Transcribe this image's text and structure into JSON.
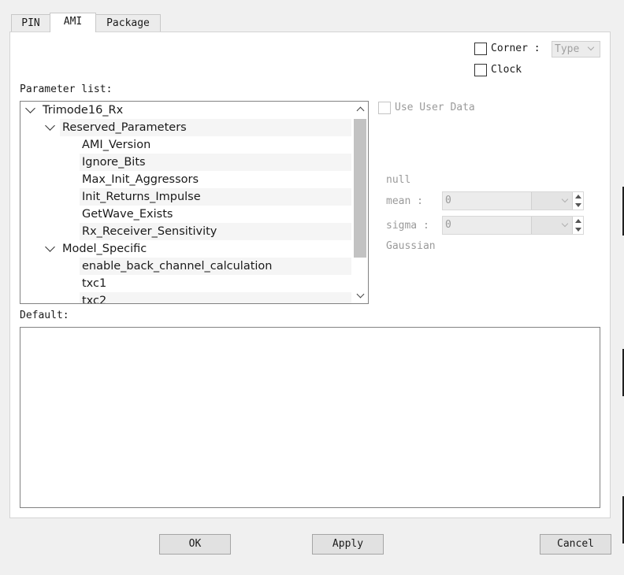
{
  "tabs": [
    {
      "label": "PIN",
      "active": false
    },
    {
      "label": "AMI",
      "active": true
    },
    {
      "label": "Package",
      "active": false
    }
  ],
  "corner": {
    "label": "Corner :",
    "checked": false,
    "combo_value": "Type"
  },
  "clock": {
    "label": "Clock",
    "checked": false
  },
  "param_list_label": "Parameter list:",
  "tree": {
    "root": "Trimode16_Rx",
    "groups": [
      {
        "label": "Reserved_Parameters",
        "items": [
          "AMI_Version",
          "Ignore_Bits",
          "Max_Init_Aggressors",
          "Init_Returns_Impulse",
          "GetWave_Exists",
          "Rx_Receiver_Sensitivity"
        ]
      },
      {
        "label": "Model_Specific",
        "items": [
          "enable_back_channel_calculation",
          "txc1",
          "txc2"
        ]
      }
    ]
  },
  "use_user_data": {
    "label": "Use User Data",
    "checked": false,
    "enabled": false
  },
  "dist": {
    "null_label": "null",
    "mean_label": "mean :",
    "mean_value": "0",
    "sigma_label": "sigma :",
    "sigma_value": "0",
    "type_label": "Gaussian"
  },
  "default_label": "Default:",
  "default_value": "",
  "buttons": {
    "ok": "OK",
    "apply": "Apply",
    "cancel": "Cancel"
  },
  "colors": {
    "window_bg": "#f0f0f0",
    "panel_bg": "#ffffff",
    "tree_border": "#828282"
  }
}
